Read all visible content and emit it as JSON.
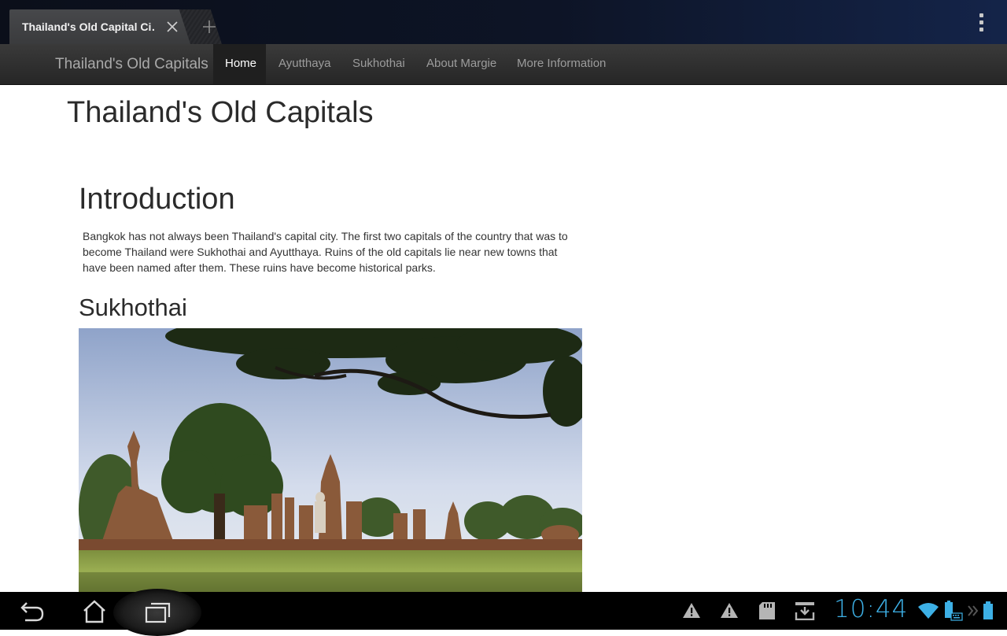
{
  "browser": {
    "tab_title": "Thailand's Old Capital Ci…",
    "close_icon": "close-icon",
    "new_tab_icon": "plus-icon",
    "menu_icon": "overflow-menu-icon"
  },
  "site_nav": {
    "brand": "Thailand's Old Capitals",
    "items": [
      {
        "label": "Home",
        "active": true
      },
      {
        "label": "Ayutthaya",
        "active": false
      },
      {
        "label": "Sukhothai",
        "active": false
      },
      {
        "label": "About Margie",
        "active": false
      },
      {
        "label": "More Information",
        "active": false
      }
    ]
  },
  "page": {
    "title": "Thailand's Old Capitals",
    "intro_heading": "Introduction",
    "intro_text": "Bangkok has not always been Thailand's capital city. The first two capitals of the country that was to become Thailand were Sukhothai and Ayutthaya. Ruins of the old capitals lie near new towns that have been named after them. These ruins have become historical parks.",
    "sukhothai_heading": "Sukhothai",
    "photo_subject": "Sukhothai temple ruins with trees"
  },
  "system_bar": {
    "clock": "10:44",
    "nav_icons": [
      "back-icon",
      "home-icon",
      "recent-apps-icon"
    ],
    "status_icons": [
      "warning-icon",
      "warning-icon",
      "sd-card-icon",
      "download-icon",
      "wifi-icon",
      "battery-keyboard-icon",
      "more-icon",
      "battery-icon"
    ]
  },
  "colors": {
    "accent_clock": "#3db0e6",
    "nav_active_bg": "#1f1f1f",
    "nav_bg": "#2e2e2e"
  }
}
